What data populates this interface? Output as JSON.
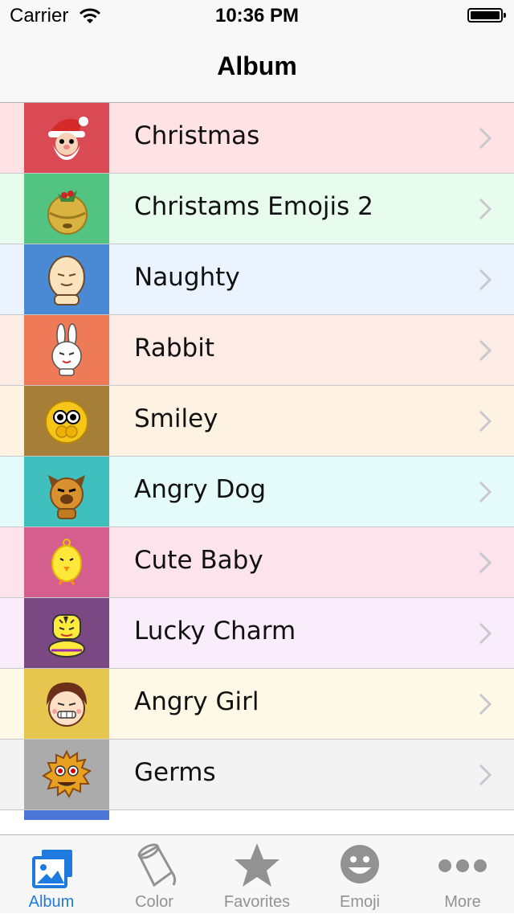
{
  "status_bar": {
    "carrier": "Carrier",
    "time": "10:36 PM"
  },
  "nav": {
    "title": "Album"
  },
  "albums": [
    {
      "label": "Christmas",
      "row_color": "#fee2e4",
      "thumb_color": "#da4a55",
      "icon": "santa-icon"
    },
    {
      "label": "Christams Emojis 2",
      "row_color": "#e8fcee",
      "thumb_color": "#52c380",
      "icon": "bell-icon"
    },
    {
      "label": "Naughty",
      "row_color": "#ebf3fe",
      "thumb_color": "#4a8ad4",
      "icon": "naughty-face-icon"
    },
    {
      "label": "Rabbit",
      "row_color": "#fdebe6",
      "thumb_color": "#ee7a58",
      "icon": "rabbit-icon"
    },
    {
      "label": "Smiley",
      "row_color": "#fef2e2",
      "thumb_color": "#a57e38",
      "icon": "smiley-icon"
    },
    {
      "label": "Angry Dog",
      "row_color": "#e5fbf9",
      "thumb_color": "#3fbfbd",
      "icon": "dog-icon"
    },
    {
      "label": "Cute Baby",
      "row_color": "#fde4ec",
      "thumb_color": "#d45f8e",
      "icon": "chick-icon"
    },
    {
      "label": "Lucky Charm",
      "row_color": "#f9edfc",
      "thumb_color": "#7a4983",
      "icon": "tiger-icon"
    },
    {
      "label": "Angry Girl",
      "row_color": "#fef8e6",
      "thumb_color": "#e6c64f",
      "icon": "girl-face-icon"
    },
    {
      "label": "Germs",
      "row_color": "#f3f3f3",
      "thumb_color": "#ababab",
      "icon": "germ-icon"
    }
  ],
  "tabs": [
    {
      "label": "Album",
      "icon": "album-icon",
      "active": true
    },
    {
      "label": "Color",
      "icon": "paint-bucket-icon",
      "active": false
    },
    {
      "label": "Favorites",
      "icon": "star-icon",
      "active": false
    },
    {
      "label": "Emoji",
      "icon": "emoji-face-icon",
      "active": false
    },
    {
      "label": "More",
      "icon": "more-icon",
      "active": false
    }
  ]
}
